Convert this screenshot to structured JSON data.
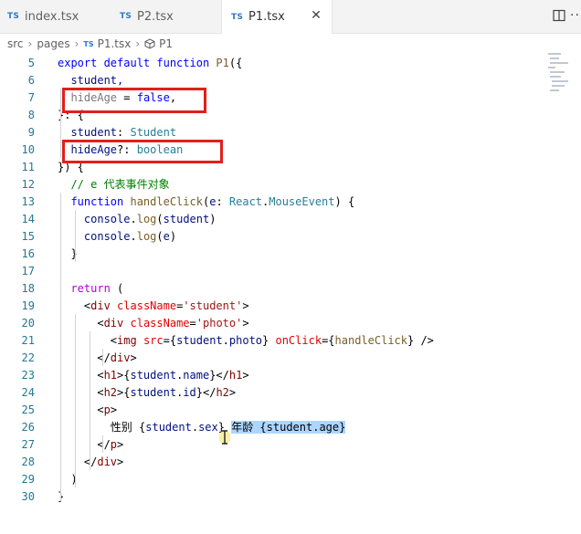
{
  "tabs": [
    {
      "badge": "TS",
      "label": "index.tsx",
      "active": false
    },
    {
      "badge": "TS",
      "label": "P2.tsx",
      "active": false
    },
    {
      "badge": "TS",
      "label": "P1.tsx",
      "active": true
    }
  ],
  "tab_close": "✕",
  "more_label": "···",
  "breadcrumb": {
    "folder1": "src",
    "folder2": "pages",
    "badge": "TS",
    "file": "P1.tsx",
    "symbol": "P1",
    "sep": "›"
  },
  "lines": [
    {
      "n": "5",
      "tokens": [
        {
          "t": "export default function ",
          "c": "kw"
        },
        {
          "t": "P1",
          "c": "fn"
        },
        {
          "t": "({",
          "c": ""
        }
      ]
    },
    {
      "n": "6",
      "tokens": [
        {
          "t": "  student,",
          "c": "var"
        }
      ]
    },
    {
      "n": "7",
      "tokens": [
        {
          "t": "  hideAge",
          "c": "dim"
        },
        {
          "t": " = ",
          "c": ""
        },
        {
          "t": "false",
          "c": "kw"
        },
        {
          "t": ",",
          "c": ""
        }
      ]
    },
    {
      "n": "8",
      "tokens": [
        {
          "t": "}: {",
          "c": ""
        }
      ]
    },
    {
      "n": "9",
      "tokens": [
        {
          "t": "  student",
          "c": "var"
        },
        {
          "t": ": ",
          "c": ""
        },
        {
          "t": "Student",
          "c": "type"
        }
      ]
    },
    {
      "n": "10",
      "tokens": [
        {
          "t": "  hideAge",
          "c": "var"
        },
        {
          "t": "?: ",
          "c": ""
        },
        {
          "t": "boolean",
          "c": "type"
        }
      ]
    },
    {
      "n": "11",
      "tokens": [
        {
          "t": "}) {",
          "c": ""
        }
      ]
    },
    {
      "n": "12",
      "tokens": [
        {
          "t": "  // e 代表事件对象",
          "c": "cmt"
        }
      ]
    },
    {
      "n": "13",
      "tokens": [
        {
          "t": "  function ",
          "c": "kw"
        },
        {
          "t": "handleClick",
          "c": "fn"
        },
        {
          "t": "(",
          "c": ""
        },
        {
          "t": "e",
          "c": "var"
        },
        {
          "t": ": ",
          "c": ""
        },
        {
          "t": "React",
          "c": "type"
        },
        {
          "t": ".",
          "c": ""
        },
        {
          "t": "MouseEvent",
          "c": "type"
        },
        {
          "t": ") {",
          "c": ""
        }
      ]
    },
    {
      "n": "14",
      "tokens": [
        {
          "t": "    console",
          "c": "var"
        },
        {
          "t": ".",
          "c": ""
        },
        {
          "t": "log",
          "c": "fn"
        },
        {
          "t": "(",
          "c": ""
        },
        {
          "t": "student",
          "c": "var"
        },
        {
          "t": ")",
          "c": ""
        }
      ]
    },
    {
      "n": "15",
      "tokens": [
        {
          "t": "    console",
          "c": "var"
        },
        {
          "t": ".",
          "c": ""
        },
        {
          "t": "log",
          "c": "fn"
        },
        {
          "t": "(",
          "c": ""
        },
        {
          "t": "e",
          "c": "var"
        },
        {
          "t": ")",
          "c": ""
        }
      ]
    },
    {
      "n": "16",
      "tokens": [
        {
          "t": "  }",
          "c": ""
        }
      ]
    },
    {
      "n": "17",
      "tokens": []
    },
    {
      "n": "18",
      "tokens": [
        {
          "t": "  return",
          "c": "kw2"
        },
        {
          "t": " (",
          "c": ""
        }
      ]
    },
    {
      "n": "19",
      "tokens": [
        {
          "t": "    <",
          "c": ""
        },
        {
          "t": "div",
          "c": "tag"
        },
        {
          "t": " ",
          "c": ""
        },
        {
          "t": "className",
          "c": "attr"
        },
        {
          "t": "=",
          "c": ""
        },
        {
          "t": "'student'",
          "c": "str"
        },
        {
          "t": ">",
          "c": ""
        }
      ]
    },
    {
      "n": "20",
      "tokens": [
        {
          "t": "      <",
          "c": ""
        },
        {
          "t": "div",
          "c": "tag"
        },
        {
          "t": " ",
          "c": ""
        },
        {
          "t": "className",
          "c": "attr"
        },
        {
          "t": "=",
          "c": ""
        },
        {
          "t": "'photo'",
          "c": "str"
        },
        {
          "t": ">",
          "c": ""
        }
      ]
    },
    {
      "n": "21",
      "tokens": [
        {
          "t": "        <",
          "c": ""
        },
        {
          "t": "img",
          "c": "tag"
        },
        {
          "t": " ",
          "c": ""
        },
        {
          "t": "src",
          "c": "attr"
        },
        {
          "t": "={",
          "c": ""
        },
        {
          "t": "student",
          "c": "var"
        },
        {
          "t": ".",
          "c": ""
        },
        {
          "t": "photo",
          "c": "var"
        },
        {
          "t": "} ",
          "c": ""
        },
        {
          "t": "onClick",
          "c": "attr"
        },
        {
          "t": "={",
          "c": ""
        },
        {
          "t": "handleClick",
          "c": "fn"
        },
        {
          "t": "} />",
          "c": ""
        }
      ]
    },
    {
      "n": "22",
      "tokens": [
        {
          "t": "      </",
          "c": ""
        },
        {
          "t": "div",
          "c": "tag"
        },
        {
          "t": ">",
          "c": ""
        }
      ]
    },
    {
      "n": "23",
      "tokens": [
        {
          "t": "      <",
          "c": ""
        },
        {
          "t": "h1",
          "c": "tag"
        },
        {
          "t": ">{",
          "c": ""
        },
        {
          "t": "student",
          "c": "var"
        },
        {
          "t": ".",
          "c": ""
        },
        {
          "t": "name",
          "c": "var"
        },
        {
          "t": "}</",
          "c": ""
        },
        {
          "t": "h1",
          "c": "tag"
        },
        {
          "t": ">",
          "c": ""
        }
      ]
    },
    {
      "n": "24",
      "tokens": [
        {
          "t": "      <",
          "c": ""
        },
        {
          "t": "h2",
          "c": "tag"
        },
        {
          "t": ">{",
          "c": ""
        },
        {
          "t": "student",
          "c": "var"
        },
        {
          "t": ".",
          "c": ""
        },
        {
          "t": "id",
          "c": "var"
        },
        {
          "t": "}</",
          "c": ""
        },
        {
          "t": "h2",
          "c": "tag"
        },
        {
          "t": ">",
          "c": ""
        }
      ]
    },
    {
      "n": "25",
      "tokens": [
        {
          "t": "      <",
          "c": ""
        },
        {
          "t": "p",
          "c": "tag"
        },
        {
          "t": ">",
          "c": ""
        }
      ]
    },
    {
      "n": "26",
      "tokens": [
        {
          "t": "        性别 {",
          "c": ""
        },
        {
          "t": "student",
          "c": "var"
        },
        {
          "t": ".",
          "c": ""
        },
        {
          "t": "sex",
          "c": "var"
        },
        {
          "t": "} ",
          "c": ""
        },
        {
          "t": "年龄 {student.age}",
          "c": "sel"
        }
      ]
    },
    {
      "n": "27",
      "tokens": [
        {
          "t": "      </",
          "c": ""
        },
        {
          "t": "p",
          "c": "tag"
        },
        {
          "t": ">",
          "c": ""
        }
      ]
    },
    {
      "n": "28",
      "tokens": [
        {
          "t": "    </",
          "c": ""
        },
        {
          "t": "div",
          "c": "tag"
        },
        {
          "t": ">",
          "c": ""
        }
      ]
    },
    {
      "n": "29",
      "tokens": [
        {
          "t": "  )",
          "c": ""
        }
      ]
    },
    {
      "n": "30",
      "tokens": [
        {
          "t": "}",
          "c": ""
        }
      ]
    }
  ]
}
